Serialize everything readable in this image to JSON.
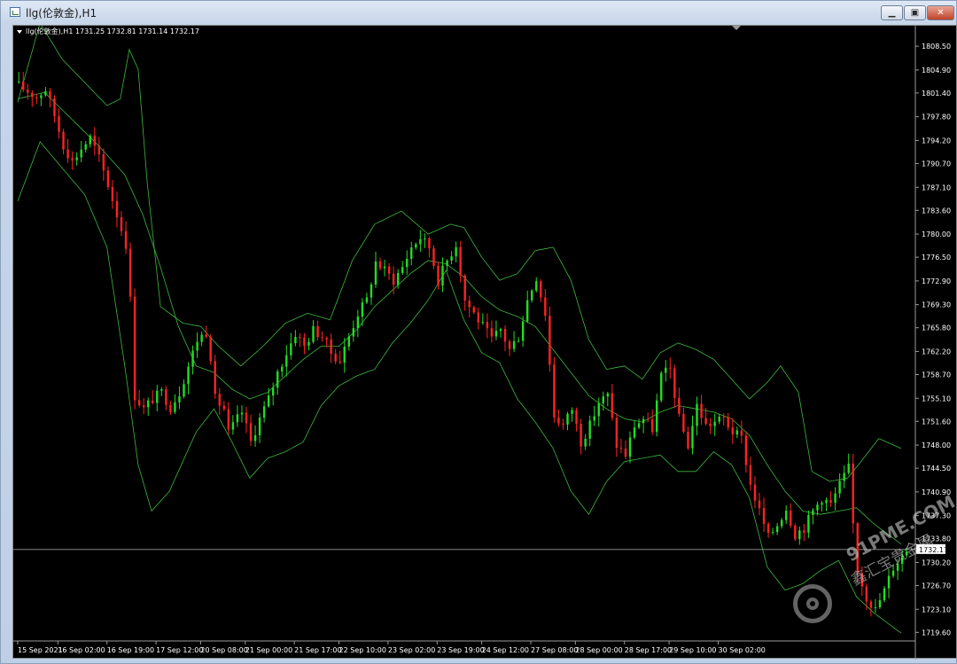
{
  "window": {
    "title": "llg(伦敦金),H1",
    "minimize_glyph": "▁",
    "restore_glyph": "▣",
    "close_glyph": "✕"
  },
  "colors": {
    "background": "#000000",
    "bull_candle": "#22dd22",
    "bear_candle": "#ff2222",
    "bands": "#3db83d",
    "axis_text": "#ffffff",
    "current_price_line": "#9a9a9a"
  },
  "watermark": {
    "line1": "91PME.COM",
    "line2": "鑫汇宝贵金属"
  },
  "chart_data": {
    "type": "candlestick",
    "symbol": "llg(伦敦金)",
    "timeframe": "H1",
    "legend": "llg(伦敦金),H1  1731.25 1732.81 1731.14 1732.17",
    "ohlc_current": {
      "open": 1731.25,
      "high": 1732.81,
      "low": 1731.14,
      "close": 1732.17
    },
    "current_price_label": "1732.17",
    "current_price": 1732.17,
    "ylim": [
      1718.3,
      1811.2
    ],
    "y_ticks": [
      "1808.50",
      "1804.90",
      "1801.40",
      "1797.80",
      "1794.20",
      "1790.70",
      "1787.10",
      "1783.60",
      "1780.00",
      "1776.50",
      "1772.90",
      "1769.30",
      "1765.80",
      "1762.20",
      "1758.70",
      "1755.10",
      "1751.60",
      "1748.00",
      "1744.50",
      "1740.90",
      "1737.30",
      "1733.80",
      "1730.20",
      "1726.70",
      "1723.10",
      "1719.60"
    ],
    "x_ticks": [
      "15 Sep 2021",
      "16 Sep 02:00",
      "16 Sep 19:00",
      "17 Sep 12:00",
      "20 Sep 08:00",
      "21 Sep 00:00",
      "21 Sep 17:00",
      "22 Sep 10:00",
      "23 Sep 02:00",
      "23 Sep 19:00",
      "24 Sep 12:00",
      "27 Sep 08:00",
      "28 Sep 00:00",
      "28 Sep 17:00",
      "29 Sep 10:00",
      "30 Sep 02:00"
    ],
    "x_tick_bar_index": [
      0,
      9,
      20,
      31,
      41,
      51,
      62,
      72,
      83,
      94,
      104,
      115,
      125,
      136,
      146,
      157
    ],
    "close_path": [
      [
        0,
        1802.5
      ],
      [
        4,
        1800.8
      ],
      [
        6,
        1802.0
      ],
      [
        8,
        1798.0
      ],
      [
        10,
        1793.5
      ],
      [
        12,
        1791.0
      ],
      [
        14,
        1793.0
      ],
      [
        16,
        1794.6
      ],
      [
        18,
        1791.5
      ],
      [
        20,
        1787.5
      ],
      [
        22,
        1783.0
      ],
      [
        24,
        1778.5
      ],
      [
        25,
        1770.0
      ],
      [
        26,
        1755.5
      ],
      [
        28,
        1753.5
      ],
      [
        30,
        1755.0
      ],
      [
        32,
        1756.0
      ],
      [
        34,
        1753.8
      ],
      [
        36,
        1756.0
      ],
      [
        38,
        1760.0
      ],
      [
        40,
        1764.0
      ],
      [
        42,
        1765.2
      ],
      [
        43,
        1761.5
      ],
      [
        44,
        1755.0
      ],
      [
        46,
        1753.5
      ],
      [
        47,
        1749.8
      ],
      [
        49,
        1752.0
      ],
      [
        50,
        1753.0
      ],
      [
        52,
        1748.5
      ],
      [
        54,
        1752.0
      ],
      [
        56,
        1755.0
      ],
      [
        58,
        1759.0
      ],
      [
        60,
        1762.0
      ],
      [
        62,
        1765.0
      ],
      [
        64,
        1763.0
      ],
      [
        66,
        1765.5
      ],
      [
        68,
        1764.5
      ],
      [
        70,
        1762.0
      ],
      [
        72,
        1760.8
      ],
      [
        74,
        1764.5
      ],
      [
        76,
        1768.0
      ],
      [
        78,
        1770.0
      ],
      [
        80,
        1775.8
      ],
      [
        82,
        1774.5
      ],
      [
        84,
        1773.0
      ],
      [
        86,
        1775.0
      ],
      [
        88,
        1778.0
      ],
      [
        90,
        1779.5
      ],
      [
        92,
        1778.0
      ],
      [
        94,
        1773.0
      ],
      [
        96,
        1776.0
      ],
      [
        98,
        1778.5
      ],
      [
        100,
        1770.0
      ],
      [
        102,
        1768.0
      ],
      [
        104,
        1766.0
      ],
      [
        106,
        1764.0
      ],
      [
        108,
        1765.5
      ],
      [
        110,
        1762.5
      ],
      [
        112,
        1764.5
      ],
      [
        114,
        1770.0
      ],
      [
        116,
        1773.5
      ],
      [
        118,
        1768.0
      ],
      [
        120,
        1752.5
      ],
      [
        122,
        1751.0
      ],
      [
        124,
        1753.5
      ],
      [
        126,
        1748.5
      ],
      [
        128,
        1751.0
      ],
      [
        130,
        1754.5
      ],
      [
        132,
        1755.5
      ],
      [
        134,
        1748.0
      ],
      [
        136,
        1746.5
      ],
      [
        138,
        1751.0
      ],
      [
        140,
        1752.0
      ],
      [
        142,
        1750.5
      ],
      [
        144,
        1758.5
      ],
      [
        146,
        1759.5
      ],
      [
        148,
        1752.0
      ],
      [
        150,
        1748.0
      ],
      [
        152,
        1754.0
      ],
      [
        154,
        1751.0
      ],
      [
        156,
        1751.5
      ],
      [
        158,
        1752.0
      ],
      [
        160,
        1750.0
      ],
      [
        162,
        1749.0
      ],
      [
        164,
        1742.0
      ],
      [
        166,
        1738.0
      ],
      [
        168,
        1734.0
      ],
      [
        170,
        1736.0
      ],
      [
        172,
        1738.5
      ],
      [
        174,
        1734.5
      ],
      [
        176,
        1735.5
      ],
      [
        178,
        1738.0
      ],
      [
        180,
        1740.0
      ],
      [
        182,
        1739.0
      ],
      [
        184,
        1742.0
      ],
      [
        186,
        1744.5
      ],
      [
        187,
        1736.0
      ],
      [
        188,
        1729.0
      ],
      [
        190,
        1725.0
      ],
      [
        192,
        1723.0
      ],
      [
        194,
        1726.0
      ],
      [
        196,
        1729.5
      ],
      [
        198,
        1731.25
      ],
      [
        199,
        1732.17
      ]
    ],
    "bollinger_upper": [
      [
        0,
        1800.0
      ],
      [
        5,
        1812.0
      ],
      [
        10,
        1806.5
      ],
      [
        15,
        1803.0
      ],
      [
        20,
        1799.5
      ],
      [
        23,
        1800.5
      ],
      [
        25,
        1808.0
      ],
      [
        27,
        1805.0
      ],
      [
        29,
        1788.0
      ],
      [
        32,
        1769.0
      ],
      [
        37,
        1766.5
      ],
      [
        41,
        1766.0
      ],
      [
        45,
        1763.0
      ],
      [
        50,
        1760.0
      ],
      [
        55,
        1763.0
      ],
      [
        60,
        1766.5
      ],
      [
        65,
        1768.0
      ],
      [
        70,
        1767.0
      ],
      [
        75,
        1776.0
      ],
      [
        80,
        1781.5
      ],
      [
        86,
        1783.5
      ],
      [
        92,
        1780.0
      ],
      [
        97,
        1781.5
      ],
      [
        100,
        1781.0
      ],
      [
        104,
        1776.5
      ],
      [
        108,
        1773.0
      ],
      [
        112,
        1774.0
      ],
      [
        116,
        1777.5
      ],
      [
        120,
        1778.0
      ],
      [
        124,
        1773.0
      ],
      [
        128,
        1764.0
      ],
      [
        132,
        1759.5
      ],
      [
        136,
        1760.0
      ],
      [
        140,
        1758.0
      ],
      [
        144,
        1762.0
      ],
      [
        148,
        1763.5
      ],
      [
        152,
        1762.5
      ],
      [
        156,
        1761.0
      ],
      [
        160,
        1758.0
      ],
      [
        164,
        1755.0
      ],
      [
        168,
        1757.5
      ],
      [
        171,
        1760.0
      ],
      [
        175,
        1756.0
      ],
      [
        178,
        1744.0
      ],
      [
        182,
        1742.5
      ],
      [
        186,
        1743.0
      ],
      [
        189,
        1745.5
      ],
      [
        193,
        1749.0
      ],
      [
        198,
        1747.5
      ]
    ],
    "bollinger_middle": [
      [
        0,
        1800.5
      ],
      [
        6,
        1801.5
      ],
      [
        12,
        1797.5
      ],
      [
        18,
        1793.5
      ],
      [
        24,
        1789.0
      ],
      [
        28,
        1783.0
      ],
      [
        32,
        1775.0
      ],
      [
        36,
        1766.0
      ],
      [
        40,
        1760.0
      ],
      [
        44,
        1759.0
      ],
      [
        48,
        1756.5
      ],
      [
        52,
        1755.0
      ],
      [
        56,
        1756.0
      ],
      [
        60,
        1758.5
      ],
      [
        64,
        1761.0
      ],
      [
        68,
        1763.0
      ],
      [
        72,
        1763.0
      ],
      [
        76,
        1765.5
      ],
      [
        80,
        1769.0
      ],
      [
        84,
        1771.5
      ],
      [
        88,
        1774.0
      ],
      [
        92,
        1776.0
      ],
      [
        96,
        1775.5
      ],
      [
        100,
        1773.5
      ],
      [
        104,
        1770.5
      ],
      [
        108,
        1768.5
      ],
      [
        112,
        1767.5
      ],
      [
        116,
        1766.0
      ],
      [
        120,
        1762.5
      ],
      [
        124,
        1759.0
      ],
      [
        128,
        1755.5
      ],
      [
        132,
        1753.5
      ],
      [
        136,
        1752.0
      ],
      [
        140,
        1751.5
      ],
      [
        144,
        1753.0
      ],
      [
        148,
        1754.0
      ],
      [
        152,
        1753.5
      ],
      [
        156,
        1753.0
      ],
      [
        160,
        1752.0
      ],
      [
        164,
        1749.5
      ],
      [
        168,
        1745.0
      ],
      [
        172,
        1741.0
      ],
      [
        176,
        1738.0
      ],
      [
        180,
        1737.5
      ],
      [
        184,
        1738.0
      ],
      [
        188,
        1738.5
      ],
      [
        192,
        1736.0
      ],
      [
        196,
        1734.0
      ],
      [
        198,
        1733.0
      ]
    ],
    "bollinger_lower": [
      [
        0,
        1785.0
      ],
      [
        5,
        1794.0
      ],
      [
        10,
        1790.0
      ],
      [
        15,
        1786.0
      ],
      [
        20,
        1778.0
      ],
      [
        24,
        1760.0
      ],
      [
        27,
        1745.0
      ],
      [
        30,
        1738.0
      ],
      [
        34,
        1741.0
      ],
      [
        40,
        1750.0
      ],
      [
        44,
        1753.5
      ],
      [
        48,
        1748.5
      ],
      [
        52,
        1743.0
      ],
      [
        56,
        1746.0
      ],
      [
        60,
        1747.0
      ],
      [
        64,
        1748.5
      ],
      [
        68,
        1754.0
      ],
      [
        72,
        1757.0
      ],
      [
        76,
        1758.5
      ],
      [
        80,
        1759.5
      ],
      [
        84,
        1763.5
      ],
      [
        88,
        1766.5
      ],
      [
        92,
        1770.0
      ],
      [
        96,
        1774.5
      ],
      [
        100,
        1767.0
      ],
      [
        104,
        1762.0
      ],
      [
        108,
        1760.5
      ],
      [
        112,
        1755.0
      ],
      [
        116,
        1751.5
      ],
      [
        120,
        1747.5
      ],
      [
        124,
        1741.0
      ],
      [
        128,
        1737.5
      ],
      [
        132,
        1742.5
      ],
      [
        136,
        1745.5
      ],
      [
        140,
        1746.0
      ],
      [
        144,
        1746.5
      ],
      [
        148,
        1744.0
      ],
      [
        152,
        1744.0
      ],
      [
        156,
        1747.0
      ],
      [
        160,
        1745.0
      ],
      [
        164,
        1740.0
      ],
      [
        168,
        1729.5
      ],
      [
        172,
        1726.0
      ],
      [
        176,
        1727.0
      ],
      [
        180,
        1729.0
      ],
      [
        184,
        1730.5
      ],
      [
        188,
        1725.0
      ],
      [
        192,
        1722.5
      ],
      [
        196,
        1720.5
      ],
      [
        198,
        1719.5
      ]
    ],
    "grid": false
  }
}
